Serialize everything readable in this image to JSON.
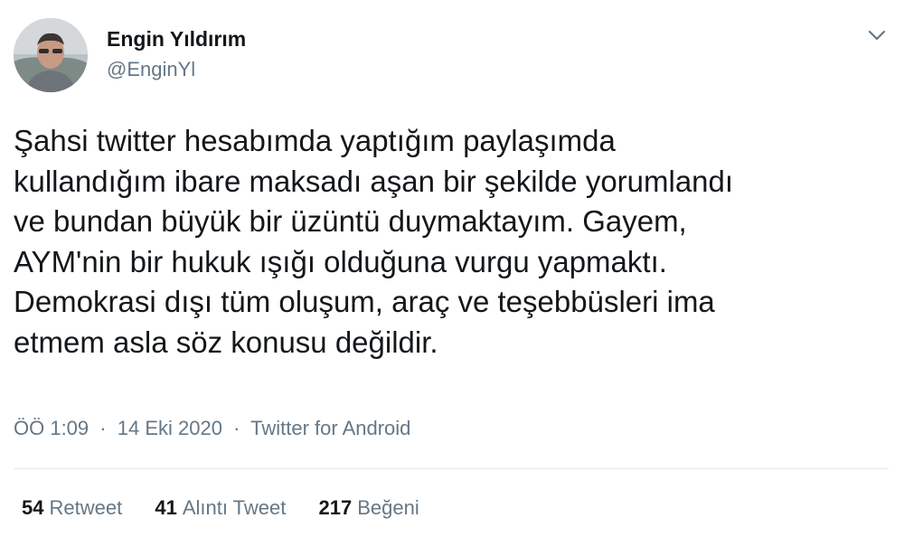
{
  "author": {
    "name": "Engin Yıldırım",
    "handle": "@EnginYl"
  },
  "tweet": {
    "lines": [
      "Şahsi twitter hesabımda yaptığım paylaşımda",
      "kullandığım ibare maksadı aşan bir şekilde yorumlandı",
      "ve bundan büyük bir üzüntü duymaktayım. Gayem,",
      "AYM'nin bir hukuk ışığı olduğuna vurgu yapmaktı.",
      "Demokrasi dışı tüm oluşum, araç ve teşebbüsleri ima",
      "etmem asla söz konusu değildir."
    ],
    "time": "ÖÖ 1:09",
    "date": "14 Eki 2020",
    "source": "Twitter for Android",
    "separator": "·"
  },
  "stats": {
    "retweets": {
      "count": "54",
      "label": "Retweet"
    },
    "quotes": {
      "count": "41",
      "label": "Alıntı Tweet"
    },
    "likes": {
      "count": "217",
      "label": "Beğeni"
    }
  },
  "icons": {
    "menu": "chevron-down-icon"
  },
  "colors": {
    "text": "#14171a",
    "secondary": "#657786",
    "divider": "#e1e8ed"
  }
}
